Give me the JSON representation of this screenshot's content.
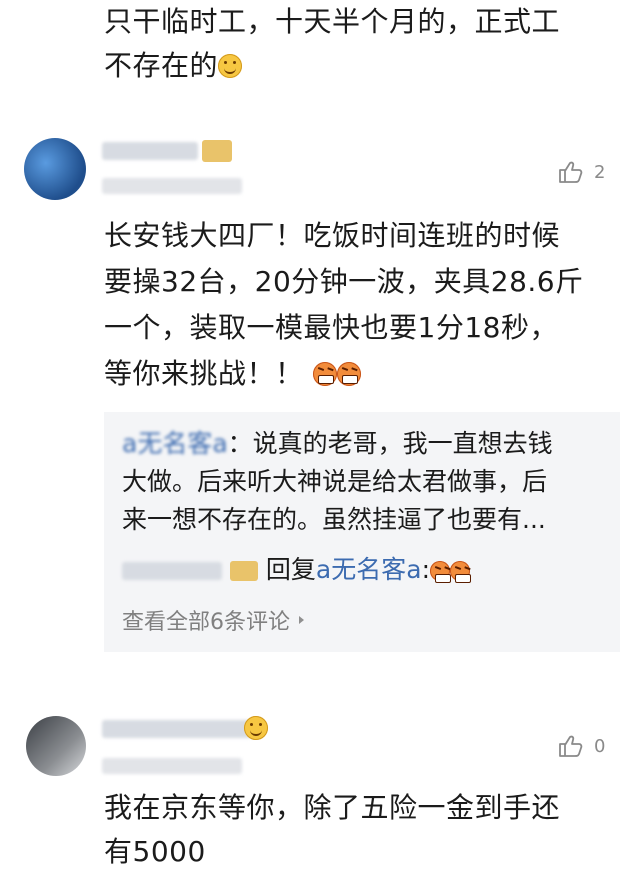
{
  "top_comment": {
    "lines": [
      "只干临时工，十天半个月的，正式工",
      "不存在的"
    ]
  },
  "comment_1": {
    "like_count": "2",
    "lines": [
      "长安钱大四厂！吃饭时间连班的时候",
      "要操32台，20分钟一波，夹具28.6斤",
      "一个，装取一模最快也要1分18秒，",
      "等你来挑战！！"
    ],
    "replies": [
      {
        "name": "a无名客a",
        "lines": [
          "：说真的老哥，我一直想去钱",
          "大做。后来听大神说是给太君做事，后",
          "来一想不存在的。虽然挂逼了也要有..."
        ]
      },
      {
        "name": "",
        "reply_to_prefix": "回复",
        "reply_to_name": "a无名客a",
        "reply_to_suffix": ":"
      }
    ],
    "see_all": "查看全部6条评论"
  },
  "comment_2": {
    "like_count": "0",
    "lines": [
      "我在京东等你，除了五险一金到手还",
      "有5000"
    ]
  },
  "icons": {
    "like": "like-thumb-icon",
    "smile": "smile-emoji-icon",
    "angry": "angry-emoji-icon",
    "arrow": "chevron-right-icon"
  },
  "colors": {
    "reply_bg": "#f4f5f7",
    "link": "#3c6bb0",
    "muted": "#8a8a8a"
  }
}
